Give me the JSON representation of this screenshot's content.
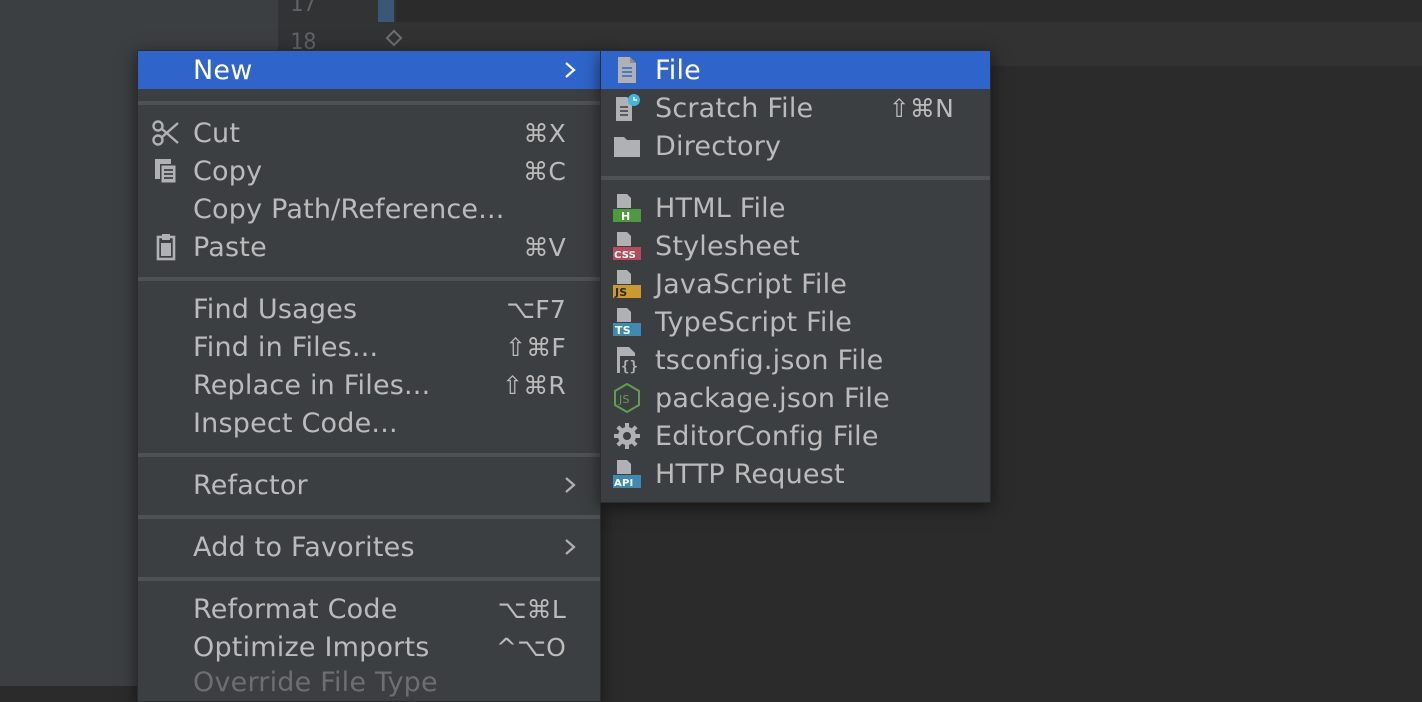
{
  "editor": {
    "line_numbers": [
      "17",
      "18"
    ]
  },
  "main_menu": {
    "items": [
      {
        "label": "New",
        "shortcut": ""
      },
      {
        "label": "Cut",
        "shortcut": "⌘X"
      },
      {
        "label": "Copy",
        "shortcut": "⌘C"
      },
      {
        "label": "Copy Path/Reference...",
        "shortcut": ""
      },
      {
        "label": "Paste",
        "shortcut": "⌘V"
      },
      {
        "label": "Find Usages",
        "shortcut": "⌥F7"
      },
      {
        "label": "Find in Files...",
        "shortcut": "⇧⌘F"
      },
      {
        "label": "Replace in Files...",
        "shortcut": "⇧⌘R"
      },
      {
        "label": "Inspect Code...",
        "shortcut": ""
      },
      {
        "label": "Refactor",
        "shortcut": ""
      },
      {
        "label": "Add to Favorites",
        "shortcut": ""
      },
      {
        "label": "Reformat Code",
        "shortcut": "⌥⌘L"
      },
      {
        "label": "Optimize Imports",
        "shortcut": "^⌥O"
      },
      {
        "label": "Override File Type",
        "shortcut": ""
      }
    ]
  },
  "sub_menu": {
    "items": [
      {
        "label": "File",
        "shortcut": ""
      },
      {
        "label": "Scratch File",
        "shortcut": "⇧⌘N"
      },
      {
        "label": "Directory",
        "shortcut": ""
      },
      {
        "label": "HTML File",
        "badge": "H"
      },
      {
        "label": "Stylesheet",
        "badge": "CSS"
      },
      {
        "label": "JavaScript File",
        "badge": "JS"
      },
      {
        "label": "TypeScript File",
        "badge": "TS"
      },
      {
        "label": "tsconfig.json File",
        "badge": "{}"
      },
      {
        "label": "package.json File",
        "badge": "JS"
      },
      {
        "label": "EditorConfig File",
        "badge": ""
      },
      {
        "label": "HTTP Request",
        "badge": "API"
      }
    ]
  },
  "colors": {
    "selection": "#2f65ca",
    "menu_bg": "#3c3f41",
    "text": "#bbbbbb",
    "html_badge": "#4e9a3e",
    "css_badge": "#b84a5c",
    "js_badge": "#c99a2e",
    "ts_badge": "#3d8bb4",
    "node_green": "#5fa04e",
    "api_badge": "#3d8bb4"
  }
}
